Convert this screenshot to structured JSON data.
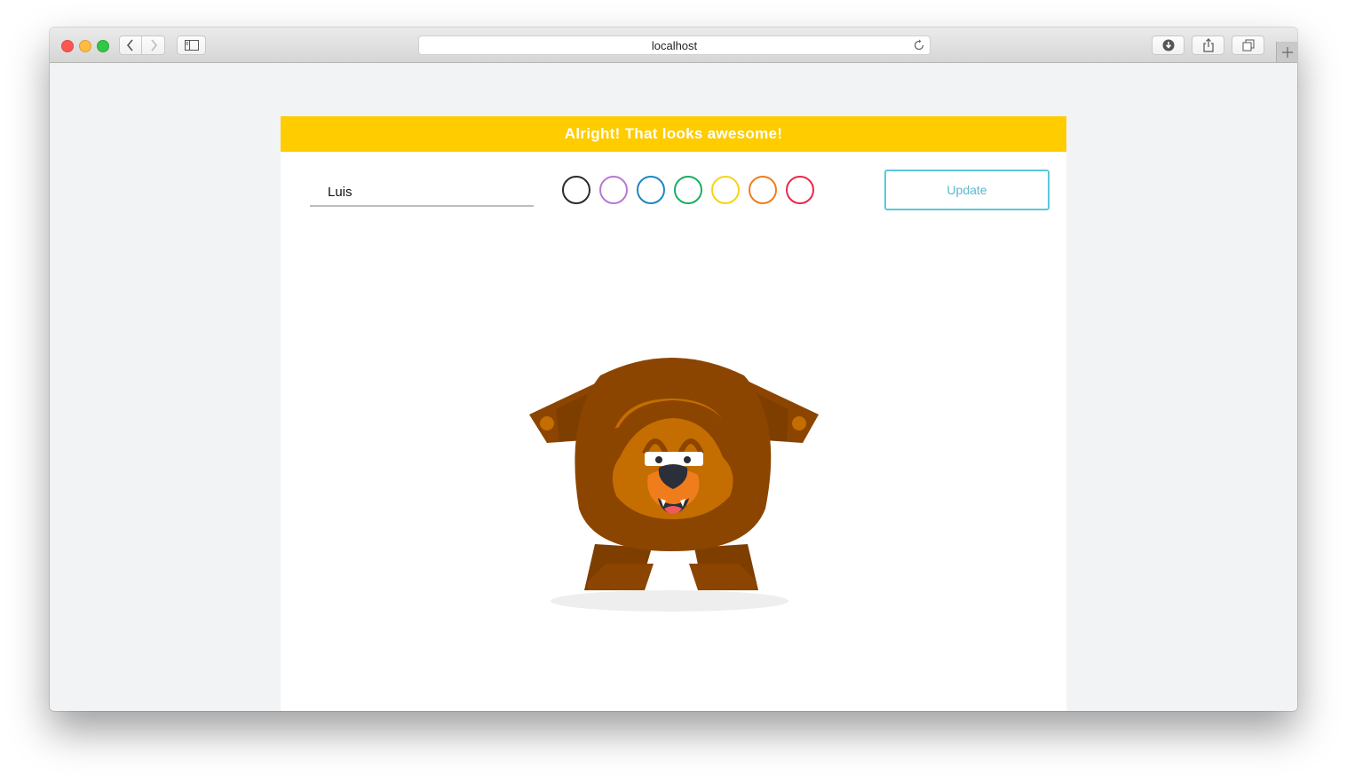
{
  "browser": {
    "url": "localhost"
  },
  "banner": {
    "message": "Alright! That looks awesome!",
    "color": "#ffcc00"
  },
  "form": {
    "name_value": "Luis",
    "update_label": "Update",
    "swatches": [
      {
        "name": "black",
        "color": "#2b2b2b"
      },
      {
        "name": "purple",
        "color": "#b57ad0"
      },
      {
        "name": "blue",
        "color": "#1f86c1"
      },
      {
        "name": "green",
        "color": "#1aae63"
      },
      {
        "name": "yellow",
        "color": "#f5d417"
      },
      {
        "name": "orange",
        "color": "#f07d1c"
      },
      {
        "name": "red",
        "color": "#ea2946"
      }
    ]
  },
  "bear": {
    "fur_color": "#8b4500",
    "belly_color": "#c46d00"
  }
}
